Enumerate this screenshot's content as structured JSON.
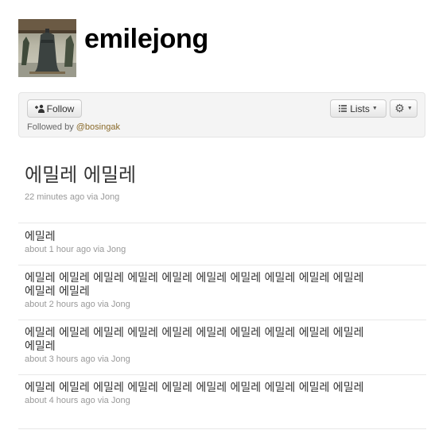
{
  "profile": {
    "username": "emilejong",
    "avatar_icon": "bell-photo-avatar"
  },
  "actions": {
    "follow_label": "Follow",
    "lists_label": "Lists",
    "gear_icon": "gear-icon",
    "followed_by_prefix": "Followed by",
    "followed_by_user": "@bosingak"
  },
  "featured_tweet": {
    "text": "에밀레 에밀레",
    "meta": "22 minutes ago via Jong"
  },
  "tweets": [
    {
      "text": "에밀레",
      "meta": "about 1 hour ago via Jong"
    },
    {
      "text": "에밀레 에밀레 에밀레 에밀레 에밀레 에밀레 에밀레 에밀레 에밀레 에밀레 에밀레 에밀레",
      "meta": "about 2 hours ago via Jong"
    },
    {
      "text": "에밀레 에밀레 에밀레 에밀레 에밀레 에밀레 에밀레 에밀레 에밀레 에밀레 에밀레",
      "meta": "about 3 hours ago via Jong"
    },
    {
      "text": "에밀레 에밀레 에밀레 에밀레 에밀레 에밀레 에밀레 에밀레 에밀레 에밀레",
      "meta": "about 4 hours ago via Jong"
    }
  ]
}
